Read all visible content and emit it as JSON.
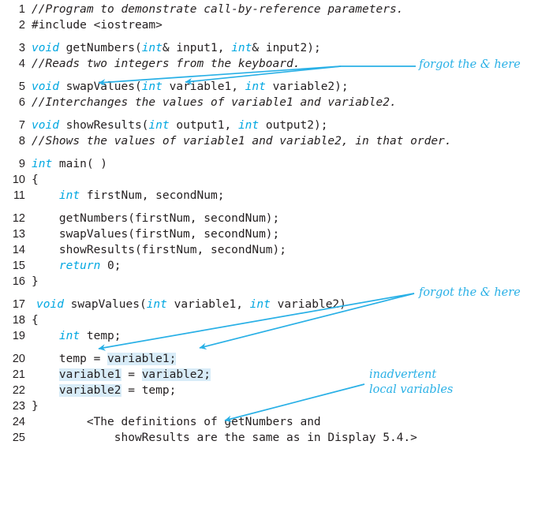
{
  "figure": {
    "title": "Display: Call-by-reference parameters with inadvertent local variables",
    "accent_color": "#00a7e1",
    "highlight_color": "#d8ecf8",
    "text_color": "#231f20"
  },
  "code": {
    "language": "cpp",
    "lines": [
      {
        "n": "1",
        "indent": 1,
        "segments": [
          {
            "t": "//Program to demonstrate call-by-reference parameters.",
            "k": "cmt"
          }
        ]
      },
      {
        "n": "2",
        "indent": 1,
        "segments": [
          {
            "t": "#include <iostream>",
            "k": "p"
          }
        ]
      },
      {
        "n": "3",
        "indent": 1,
        "segments": [
          {
            "t": "void",
            "k": "kw"
          },
          {
            "t": " getNumbers(",
            "k": "p"
          },
          {
            "t": "int",
            "k": "kw"
          },
          {
            "t": "& input1, ",
            "k": "p"
          },
          {
            "t": "int",
            "k": "kw"
          },
          {
            "t": "& input2);",
            "k": "p"
          }
        ]
      },
      {
        "n": "4",
        "indent": 1,
        "segments": [
          {
            "t": "//Reads two integers from the keyboard.",
            "k": "cmt"
          }
        ]
      },
      {
        "n": "5",
        "indent": 1,
        "segments": [
          {
            "t": "void",
            "k": "kw"
          },
          {
            "t": " swapValues(",
            "k": "p"
          },
          {
            "t": "int",
            "k": "kw"
          },
          {
            "t": " variable1, ",
            "k": "p"
          },
          {
            "t": "int",
            "k": "kw"
          },
          {
            "t": " variable2);",
            "k": "p"
          }
        ]
      },
      {
        "n": "6",
        "indent": 1,
        "segments": [
          {
            "t": "//Interchanges the values of variable1 and variable2.",
            "k": "cmt"
          }
        ]
      },
      {
        "n": "7",
        "indent": 1,
        "segments": [
          {
            "t": "void",
            "k": "kw"
          },
          {
            "t": " showResults(",
            "k": "p"
          },
          {
            "t": "int",
            "k": "kw"
          },
          {
            "t": " output1, ",
            "k": "p"
          },
          {
            "t": "int",
            "k": "kw"
          },
          {
            "t": " output2);",
            "k": "p"
          }
        ]
      },
      {
        "n": "8",
        "indent": 1,
        "segments": [
          {
            "t": "//Shows the values of variable1 and variable2, in that order.",
            "k": "cmt"
          }
        ]
      },
      {
        "n": "9",
        "indent": 1,
        "segments": [
          {
            "t": "int",
            "k": "kw"
          },
          {
            "t": " main( )",
            "k": "p"
          }
        ]
      },
      {
        "n": "10",
        "indent": 1,
        "segments": [
          {
            "t": "{",
            "k": "p"
          }
        ]
      },
      {
        "n": "11",
        "indent": 1,
        "segments": [
          {
            "t": "    ",
            "k": "p"
          },
          {
            "t": "int",
            "k": "kw"
          },
          {
            "t": " firstNum, secondNum;",
            "k": "p"
          }
        ]
      },
      {
        "n": "12",
        "indent": 1,
        "segments": [
          {
            "t": "    getNumbers(firstNum, secondNum);",
            "k": "p"
          }
        ]
      },
      {
        "n": "13",
        "indent": 1,
        "segments": [
          {
            "t": "    swapValues(firstNum, secondNum);",
            "k": "p"
          }
        ]
      },
      {
        "n": "14",
        "indent": 1,
        "segments": [
          {
            "t": "    showResults(firstNum, secondNum);",
            "k": "p"
          }
        ]
      },
      {
        "n": "15",
        "indent": 1,
        "segments": [
          {
            "t": "    ",
            "k": "p"
          },
          {
            "t": "return",
            "k": "kw"
          },
          {
            "t": " 0;",
            "k": "p"
          }
        ]
      },
      {
        "n": "16",
        "indent": 1,
        "segments": [
          {
            "t": "}",
            "k": "p"
          }
        ]
      },
      {
        "n": "17",
        "indent": 2,
        "segments": [
          {
            "t": "void",
            "k": "kw"
          },
          {
            "t": " swapValues(",
            "k": "p"
          },
          {
            "t": "int",
            "k": "kw"
          },
          {
            "t": " variable1, ",
            "k": "p"
          },
          {
            "t": "int",
            "k": "kw"
          },
          {
            "t": " variable2)",
            "k": "p"
          }
        ]
      },
      {
        "n": "18",
        "indent": 1,
        "segments": [
          {
            "t": "{",
            "k": "p"
          }
        ]
      },
      {
        "n": "19",
        "indent": 1,
        "segments": [
          {
            "t": "    ",
            "k": "p"
          },
          {
            "t": "int",
            "k": "kw"
          },
          {
            "t": " temp;",
            "k": "p"
          }
        ]
      },
      {
        "n": "20",
        "indent": 1,
        "segments": [
          {
            "t": "    temp = ",
            "k": "p"
          },
          {
            "t": "variable1;",
            "k": "hl"
          }
        ]
      },
      {
        "n": "21",
        "indent": 1,
        "segments": [
          {
            "t": "    ",
            "k": "p"
          },
          {
            "t": "variable1",
            "k": "hl"
          },
          {
            "t": " = ",
            "k": "p"
          },
          {
            "t": "variable2;",
            "k": "hl"
          }
        ]
      },
      {
        "n": "22",
        "indent": 1,
        "segments": [
          {
            "t": "    ",
            "k": "p"
          },
          {
            "t": "variable2",
            "k": "hl"
          },
          {
            "t": " = temp;",
            "k": "p"
          }
        ]
      },
      {
        "n": "23",
        "indent": 1,
        "segments": [
          {
            "t": "}",
            "k": "p"
          }
        ]
      },
      {
        "n": "24",
        "indent": 1,
        "segments": [
          {
            "t": "        <The definitions of getNumbers and",
            "k": "p"
          }
        ]
      },
      {
        "n": "25",
        "indent": 1,
        "segments": [
          {
            "t": "            showResults are the same as in Display 5.4.>",
            "k": "p"
          }
        ]
      }
    ]
  },
  "annotations": [
    {
      "id": "annot-forgot-amp-top",
      "text": "forgot the & here"
    },
    {
      "id": "annot-forgot-amp-bottom",
      "text": "forgot the & here"
    },
    {
      "id": "annot-inadvertent-l1",
      "text": "inadvertent"
    },
    {
      "id": "annot-inadvertent-l2",
      "text": "local variables"
    }
  ]
}
